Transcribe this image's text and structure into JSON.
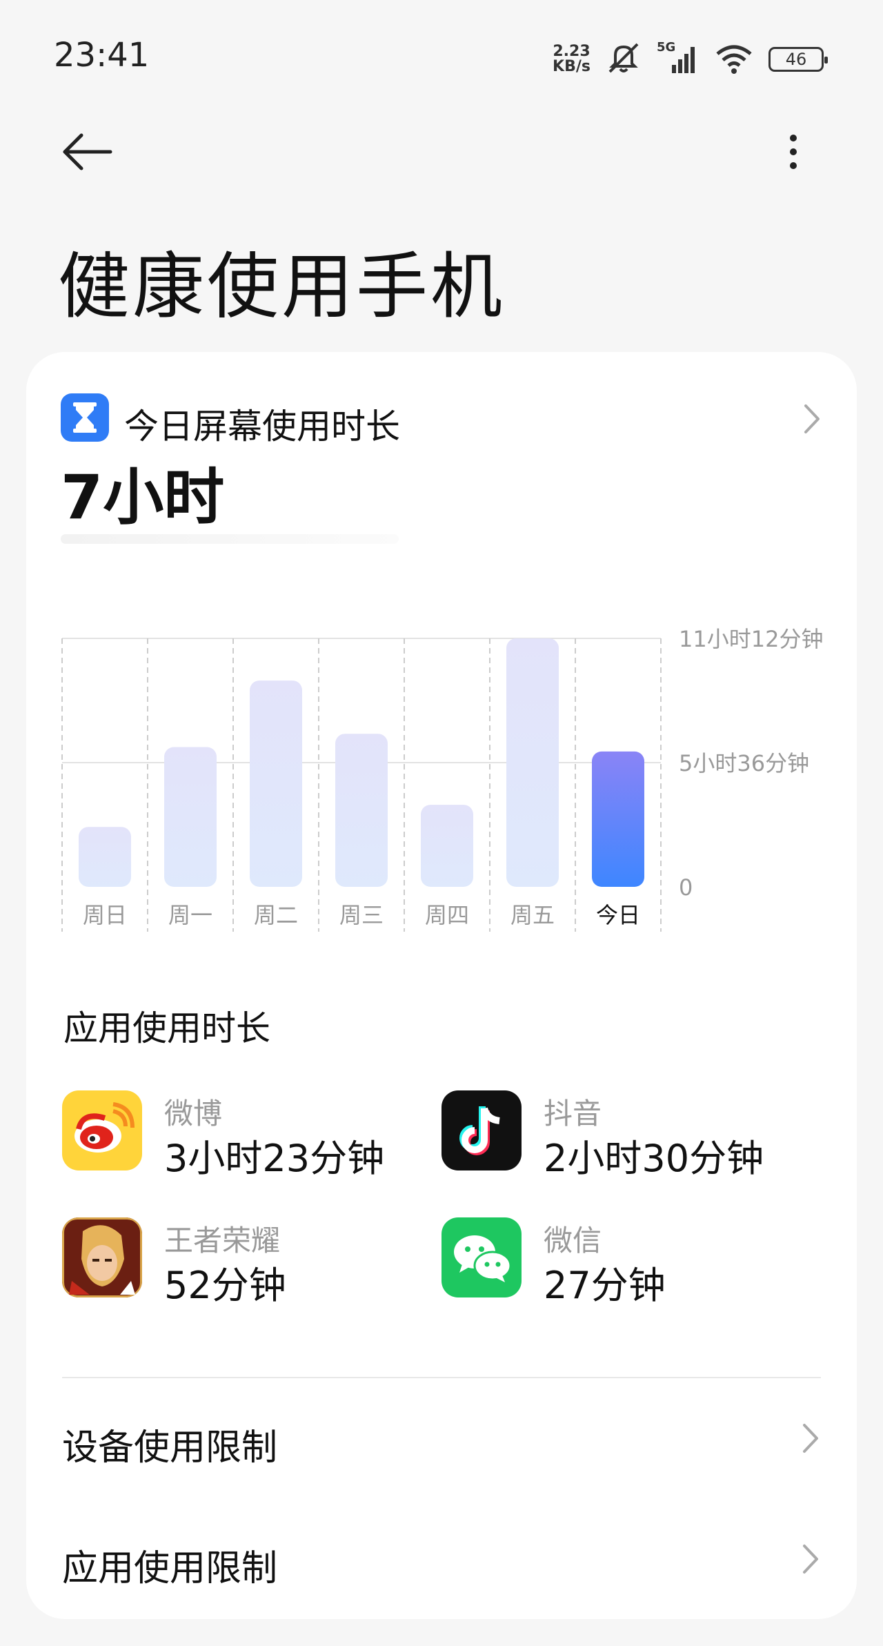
{
  "status_bar": {
    "time": "23:41",
    "net_speed_value": "2.23",
    "net_speed_unit": "KB/s",
    "network_type": "5G",
    "battery": "46",
    "icons": [
      "mute-icon",
      "signal-icon",
      "wifi-icon",
      "battery-icon"
    ]
  },
  "nav": {
    "back_icon": "arrow-left-icon",
    "more_icon": "more-vertical-icon"
  },
  "page_title": "健康使用手机",
  "screen_time": {
    "label": "今日屏幕使用时长",
    "value": "7小时",
    "icon": "hourglass-icon",
    "accent_color": "#2f7cf6"
  },
  "chart_data": {
    "type": "bar",
    "categories": [
      "周日",
      "周一",
      "周二",
      "周三",
      "周四",
      "周五",
      "今日"
    ],
    "values": [
      2.7,
      6.3,
      9.3,
      6.9,
      3.7,
      11.2,
      6.1
    ],
    "unit": "hours",
    "ylim": [
      0,
      11.2
    ],
    "y_tick_labels": [
      "11小时12分钟",
      "5小时36分钟",
      "0"
    ],
    "y_tick_values": [
      11.2,
      5.6,
      0
    ],
    "highlight_index": 6,
    "colors": {
      "bar": "#e4e7fb",
      "highlight_top": "#8a84f6",
      "highlight_bottom": "#3e86ff",
      "grid": "#dddddd"
    },
    "grid": true
  },
  "app_usage": {
    "title": "应用使用时长",
    "apps": [
      {
        "name": "微博",
        "time": "3小时23分钟",
        "icon": "weibo-icon"
      },
      {
        "name": "抖音",
        "time": "2小时30分钟",
        "icon": "douyin-icon"
      },
      {
        "name": "王者荣耀",
        "time": "52分钟",
        "icon": "honor-of-kings-icon"
      },
      {
        "name": "微信",
        "time": "27分钟",
        "icon": "wechat-icon"
      }
    ]
  },
  "menu": [
    {
      "label": "设备使用限制"
    },
    {
      "label": "应用使用限制"
    }
  ]
}
